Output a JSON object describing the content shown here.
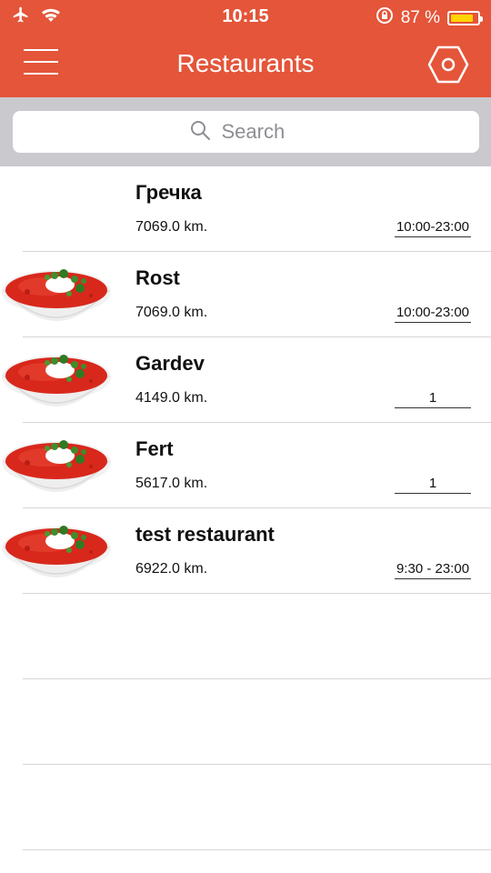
{
  "status_bar": {
    "time": "10:15",
    "battery_text": "87 %",
    "battery_level": 0.87,
    "icons": [
      "airplane-icon",
      "wifi-icon",
      "rotation-lock-icon",
      "battery-icon"
    ]
  },
  "navbar": {
    "title": "Restaurants",
    "menu_icon": "hamburger-menu-icon",
    "settings_icon": "hexagon-settings-icon",
    "color": "#e4553a"
  },
  "search": {
    "placeholder": "Search",
    "value": ""
  },
  "restaurants": [
    {
      "name": "Гречка",
      "distance": "7069.0 km.",
      "hours": "10:00-23:00",
      "has_image": false
    },
    {
      "name": "Rost",
      "distance": "7069.0 km.",
      "hours": "10:00-23:00",
      "has_image": true
    },
    {
      "name": "Gardev",
      "distance": "4149.0 km.",
      "hours": "1",
      "has_image": true
    },
    {
      "name": "Fert",
      "distance": "5617.0 km.",
      "hours": "1",
      "has_image": true
    },
    {
      "name": "test restaurant",
      "distance": "6922.0 km.",
      "hours": "9:30 - 23:00",
      "has_image": true
    }
  ]
}
